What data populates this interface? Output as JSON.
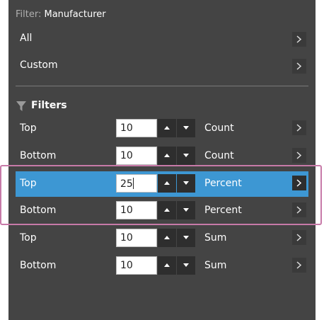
{
  "header": {
    "label": "Filter:",
    "field": "Manufacturer"
  },
  "presets": [
    {
      "label": "All"
    },
    {
      "label": "Custom"
    }
  ],
  "filters_section": {
    "title": "Filters",
    "icon": "funnel-icon"
  },
  "filter_rows": [
    {
      "type": "Top",
      "value": "10",
      "unit": "Count",
      "selected": false
    },
    {
      "type": "Bottom",
      "value": "10",
      "unit": "Count",
      "selected": false
    },
    {
      "type": "Top",
      "value": "25",
      "unit": "Percent",
      "selected": true
    },
    {
      "type": "Bottom",
      "value": "10",
      "unit": "Percent",
      "selected": false
    },
    {
      "type": "Top",
      "value": "10",
      "unit": "Sum",
      "selected": false
    },
    {
      "type": "Bottom",
      "value": "10",
      "unit": "Sum",
      "selected": false
    }
  ],
  "colors": {
    "panel_bg": "#444444",
    "selected_bg": "#3d97d3",
    "highlight_border": "#c77aa8"
  }
}
